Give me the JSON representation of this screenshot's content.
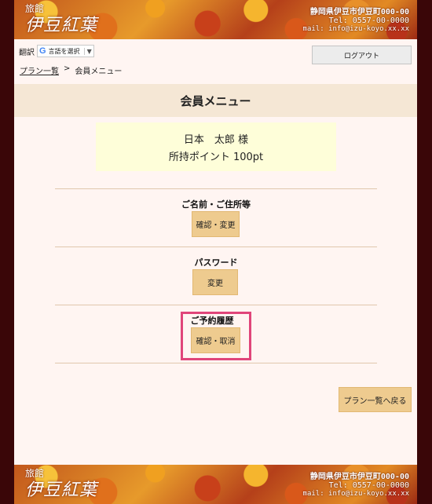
{
  "header": {
    "logo_small": "旅館",
    "logo_big": "伊豆紅葉",
    "address": "静岡県伊豆市伊豆町000-00",
    "tel": "Tel: 0557-00-0000",
    "mail": "mail: info@izu-koyo.xx.xx"
  },
  "translate": {
    "label": "翻訳",
    "select_text": "言語を選択",
    "arrow": "▼",
    "g": "G"
  },
  "toolbar": {
    "logout_label": "ログアウト"
  },
  "breadcrumb": {
    "plan_list": "プラン一覧",
    "separator": ">",
    "current": "会員メニュー"
  },
  "page": {
    "title": "会員メニュー"
  },
  "user": {
    "name": "日本　太郎 様",
    "points": "所持ポイント 100pt"
  },
  "sections": {
    "address": {
      "label": "ご名前・ご住所等",
      "button": "確認・変更"
    },
    "password": {
      "label": "パスワード",
      "button": "変更"
    },
    "history": {
      "label": "ご予約履歴",
      "button": "確認・取消"
    }
  },
  "footer": {
    "back_button": "プラン一覧へ戻る"
  },
  "colors": {
    "accent": "#eecb8f",
    "highlight": "#e0457a",
    "title_bg": "#f5e7d5"
  }
}
